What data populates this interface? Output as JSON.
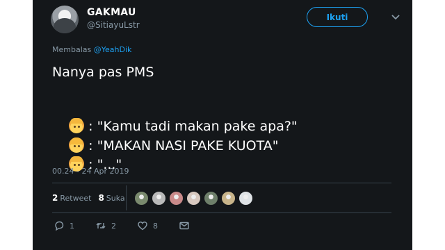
{
  "author": {
    "name": "GAKMAU",
    "handle": "@SitiayuLstr"
  },
  "follow_label": "Ikuti",
  "reply": {
    "prefix": "Membalas",
    "mention": "@YeahDik"
  },
  "tweet_lines": {
    "line1": "Nanya pas PMS",
    "line2": ": \"Kamu tadi makan pake apa?\"",
    "line3": ": \"MAKAN NASI PAKE KUOTA\"",
    "line4": ": \"...\""
  },
  "timestamp": "00.24 - 24 Apr 2019",
  "stats": {
    "retweets_count": "2",
    "retweets_label": "Retweet",
    "likes_count": "8",
    "likes_label": "Suka"
  },
  "liker_colors": [
    "#7a8a6e",
    "#b9b9b9",
    "#c98a8a",
    "#d8c9c0",
    "#6e7f6a",
    "#c8b48a",
    "#dfe3e6"
  ],
  "actions": {
    "reply_count": "1",
    "retweet_count": "2",
    "like_count": "8"
  },
  "colors": {
    "background": "#14171a",
    "accent": "#1da1f2",
    "muted": "#8899a6"
  }
}
